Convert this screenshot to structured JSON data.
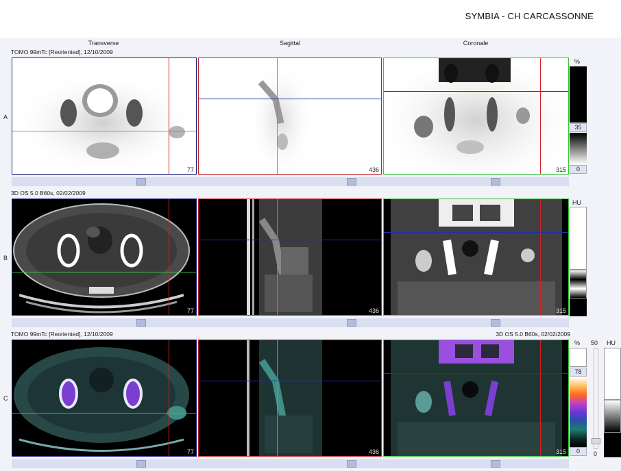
{
  "header": {
    "title": "SYMBIA - CH CARCASSONNE"
  },
  "columns": [
    "Transverse",
    "Sagittal",
    "Coronale"
  ],
  "rows": {
    "A": {
      "label": "A",
      "series": "TOMO 99mTc [Reoriented], 12/10/2009",
      "slices": [
        "77",
        "436",
        "315"
      ]
    },
    "B": {
      "label": "B",
      "series": "3D  OS  5.0  B60s, 02/02/2009",
      "slices": [
        "77",
        "436",
        "315"
      ]
    },
    "C": {
      "label": "C",
      "series": "TOMO 99mTc [Reoriented], 12/10/2009",
      "series_right": "3D  OS  5.0  B60s, 02/02/2009",
      "slices": [
        "77",
        "436",
        "315"
      ]
    }
  },
  "scales": {
    "A": {
      "unit": "%",
      "window_top": "35",
      "window_bottom": "0"
    },
    "B": {
      "unit": "HU"
    },
    "C": {
      "unit_pet": "%",
      "unit_ct": "HU",
      "pet_top": "78",
      "pet_bottom": "0",
      "slider_top": "50",
      "slider_bottom": "0"
    }
  },
  "colors": {
    "crosshair_red": "#d62020",
    "crosshair_blue": "#2030b0",
    "crosshair_green": "#3cc23c",
    "panel_bg": "#f1f3f8"
  }
}
